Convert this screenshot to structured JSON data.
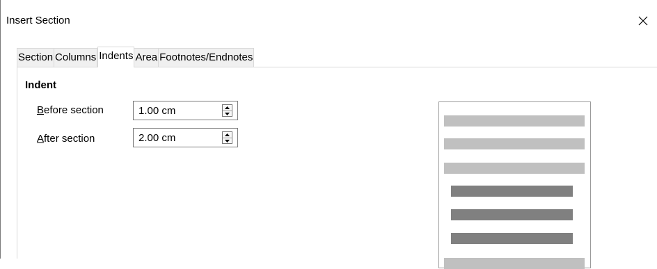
{
  "window": {
    "title": "Insert Section",
    "close_icon": "close-icon"
  },
  "tabs": [
    {
      "label": "Section",
      "active": false
    },
    {
      "label": "Columns",
      "active": false
    },
    {
      "label": "Indents",
      "active": true
    },
    {
      "label": "Area",
      "active": false
    },
    {
      "label": "Footnotes/Endnotes",
      "active": false
    }
  ],
  "indent": {
    "group_title": "Indent",
    "before": {
      "label_mnemonic": "B",
      "label_rest": "efore section",
      "value": "1.00 cm"
    },
    "after": {
      "label_mnemonic": "A",
      "label_rest": "fter section",
      "value": "2.00 cm"
    }
  },
  "preview": {
    "colors": {
      "surrounding_text": "#c0c0c0",
      "section_text": "#808080",
      "border": "#9a9a9a"
    }
  }
}
